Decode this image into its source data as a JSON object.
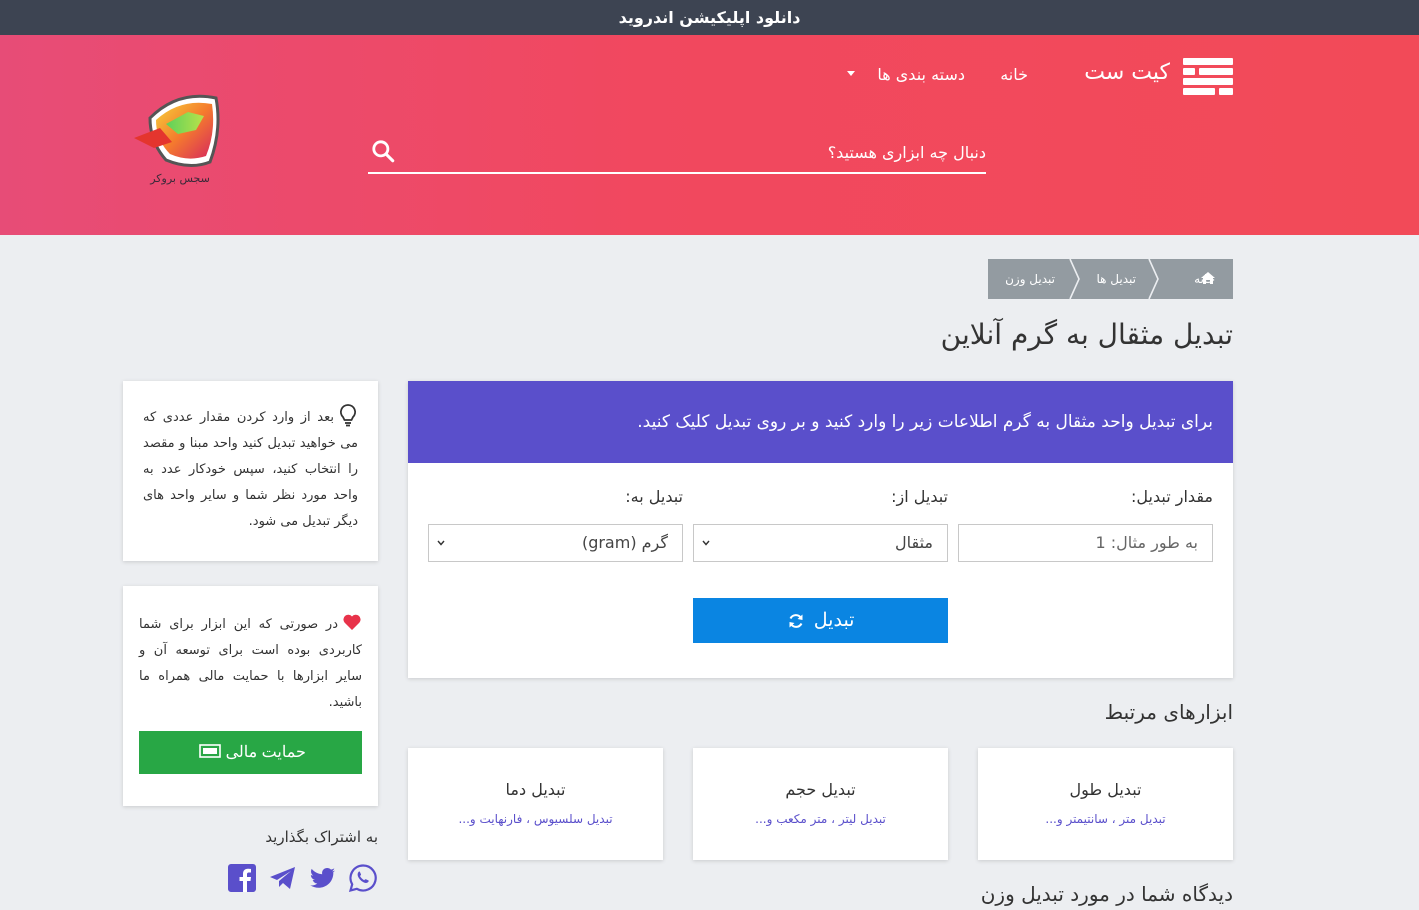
{
  "topbar": {
    "text": "دانلود اپلیکیشن اندروید"
  },
  "header": {
    "brand": "کیت ست",
    "nav_home": "خانه",
    "nav_categories": "دسته بندی ها",
    "search_placeholder": "دنبال چه ابزاری هستید؟",
    "side_logo_text": "سجس بروکر"
  },
  "breadcrumb": {
    "home": "خانه",
    "conversions": "تبدیل ها",
    "current": "تبدیل وزن"
  },
  "page_title": "تبدیل مثقال به گرم آنلاین",
  "converter": {
    "header": "برای تبدیل واحد مثقال به گرم اطلاعات زیر را وارد کنید و بر روی تبدیل کلیک کنید.",
    "amount_label": "مقدار تبدیل:",
    "amount_placeholder": "به طور مثال: 1",
    "from_label": "تبدیل از:",
    "from_value": "مثقال",
    "to_label": "تبدیل به:",
    "to_value": "گرم (gram)",
    "button": "تبدیل"
  },
  "sidebar": {
    "tip_text": "بعد از وارد کردن مقدار عددی که می خواهید تبدیل کنید واحد مبنا و مقصد را انتخاب کنید، سپس خودکار عدد به واحد مورد نظر شما و سایر واحد های دیگر تبدیل می شود.",
    "donate_text": "در صورتی که این ابزار برای شما کاربردی بوده است برای توسعه آن و سایر ابزارها با حمایت مالی همراه ما باشید.",
    "donate_button": "حمایت مالی",
    "share_label": "به اشتراک بگذارید"
  },
  "related": {
    "title": "ابزارهای مرتبط",
    "tools": [
      {
        "title": "تبدیل طول",
        "sub": "تبدیل متر ، سانتیمتر و..."
      },
      {
        "title": "تبدیل حجم",
        "sub": "تبدیل لیتر ، متر مکعب و..."
      },
      {
        "title": "تبدیل دما",
        "sub": "تبدیل سلسیوس ، فارنهایت و..."
      }
    ]
  },
  "comments_title": "دیدگاه شما در مورد تبدیل وزن",
  "colors": {
    "header_accent": "#f1485f",
    "topbar": "#3d4452",
    "converter_header": "#5a4fcb",
    "convert_button": "#0a85e2",
    "donate_button": "#28a745",
    "breadcrumb": "#939ba1"
  },
  "icons": [
    "menu-logo-icon",
    "search-icon",
    "home-icon",
    "refresh-icon",
    "lightbulb-icon",
    "heart-icon",
    "money-icon",
    "facebook-icon",
    "telegram-icon",
    "twitter-icon",
    "whatsapp-icon"
  ]
}
